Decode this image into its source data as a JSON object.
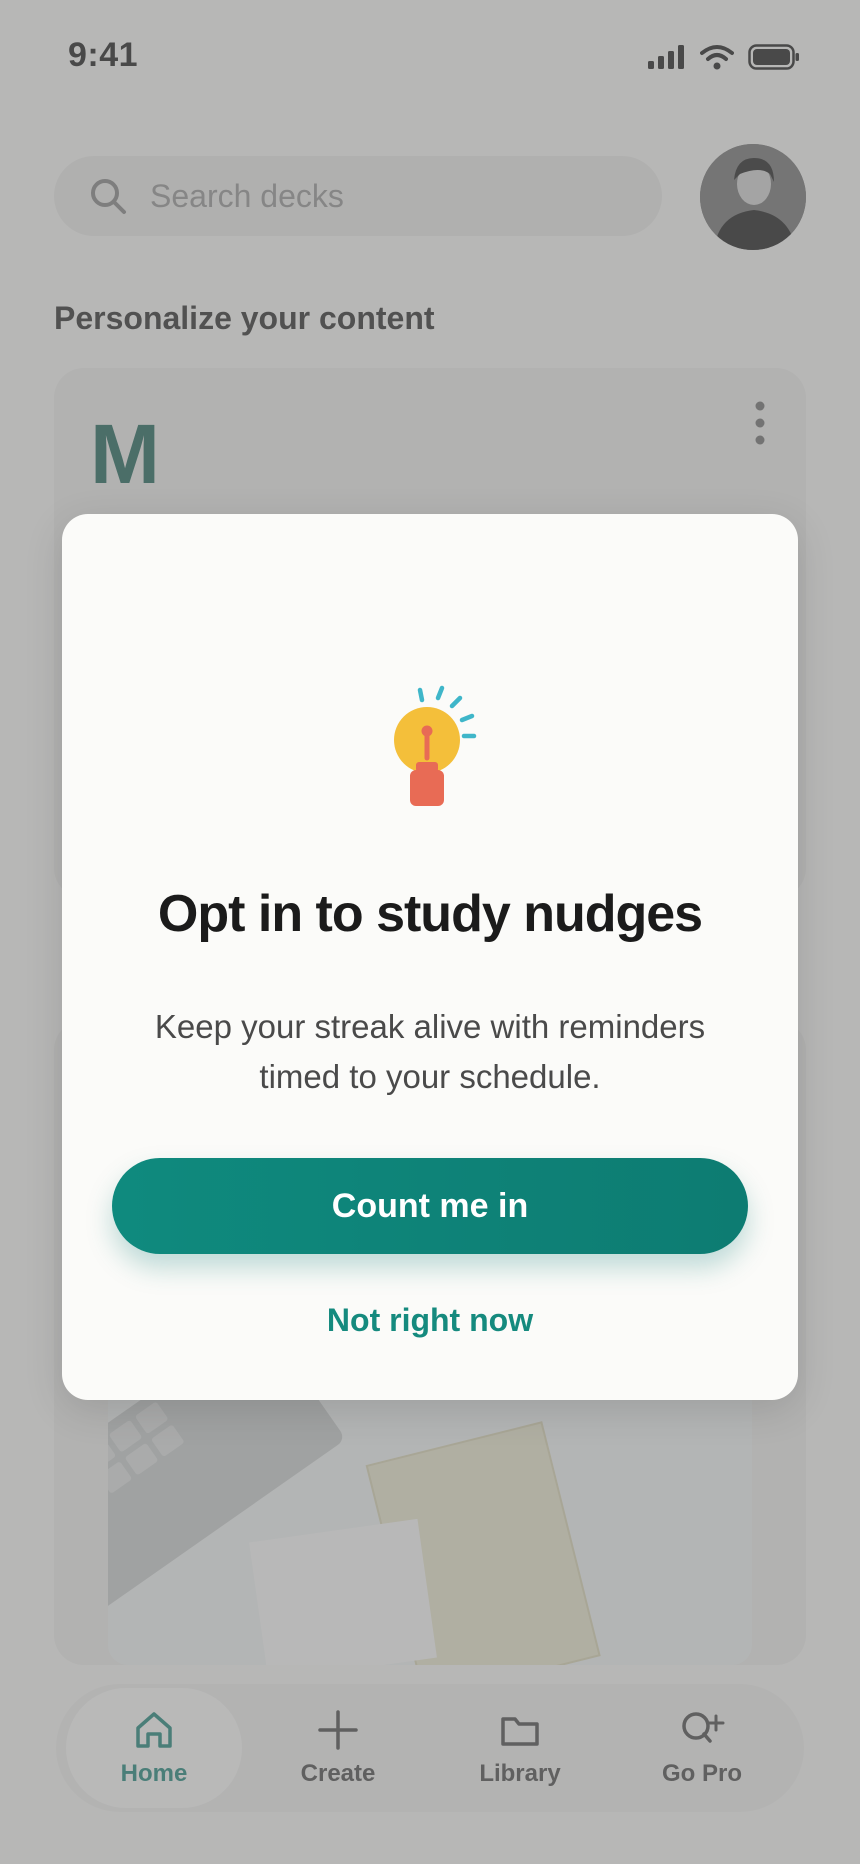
{
  "status_bar": {
    "time": "9:41"
  },
  "search": {
    "placeholder": "Search decks"
  },
  "sections": {
    "personalize_title": "Personalize your content",
    "card_letter": "M"
  },
  "modal": {
    "title": "Opt in to study nudges",
    "body": "Keep your streak alive with reminders timed to your schedule.",
    "primary_label": "Count me in",
    "secondary_label": "Not right now",
    "icon": "lightbulb-icon"
  },
  "nav": {
    "items": [
      {
        "label": "Home",
        "icon": "home-icon",
        "active": true
      },
      {
        "label": "Create",
        "icon": "plus-icon",
        "active": false
      },
      {
        "label": "Library",
        "icon": "folder-icon",
        "active": false
      },
      {
        "label": "Go Pro",
        "icon": "search-plus-icon",
        "active": false
      }
    ]
  },
  "colors": {
    "accent": "#0f8a7e",
    "bulb": "#f4bf3a",
    "base": "#e86b55",
    "rays": "#3fb6c9"
  }
}
